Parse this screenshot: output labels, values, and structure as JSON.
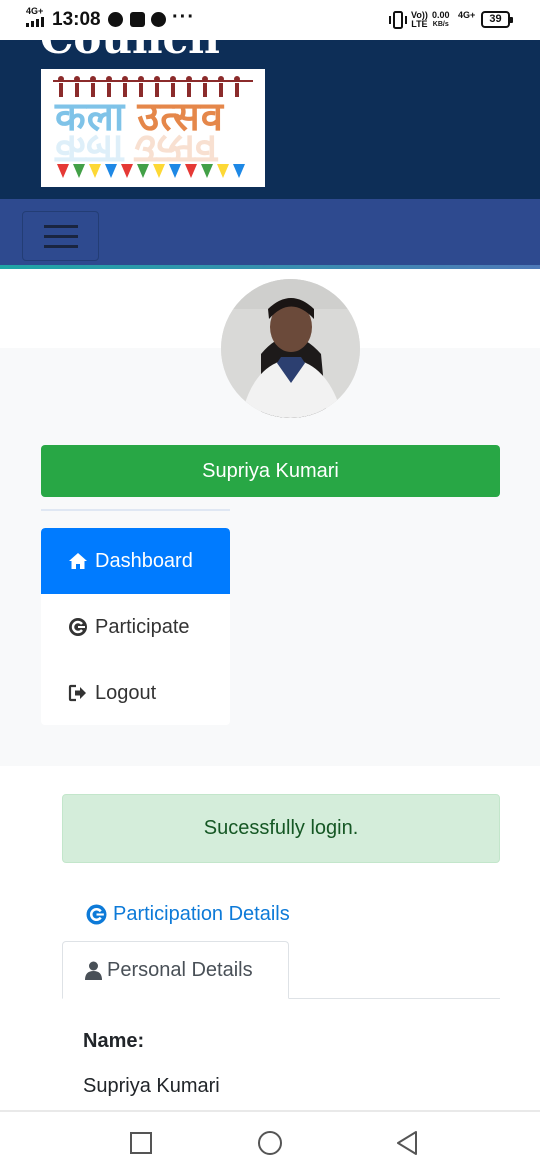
{
  "status_bar": {
    "network": "4G+",
    "time": "13:08",
    "dots": "···",
    "volte_top": "Vo))",
    "volte_bottom": "LTE",
    "speed_top": "0.00",
    "speed_bottom": "KB/s",
    "network2": "4G+",
    "battery": "39"
  },
  "header": {
    "brand_partial": "Council",
    "logo_text_kala": "कला",
    "logo_text_utsav": "उत्सव",
    "menu_toggle_icon": "hamburger-icon"
  },
  "profile": {
    "name_button": "Supriya Kumari"
  },
  "menu": {
    "items": [
      {
        "label": "Dashboard",
        "icon": "home-icon",
        "active": true
      },
      {
        "label": "Participate",
        "icon": "participate-icon",
        "active": false
      },
      {
        "label": "Logout",
        "icon": "logout-icon",
        "active": false
      }
    ]
  },
  "content": {
    "alert": "Sucessfully login.",
    "participation_link": "Participation Details",
    "tab_personal": "Personal Details",
    "name_label": "Name:",
    "name_value": "Supriya Kumari"
  },
  "colors": {
    "header_dark": "#0d2e57",
    "nav_blue": "#2e4a8f",
    "success": "#28a745",
    "primary": "#007bff",
    "link": "#0d7ad8"
  }
}
